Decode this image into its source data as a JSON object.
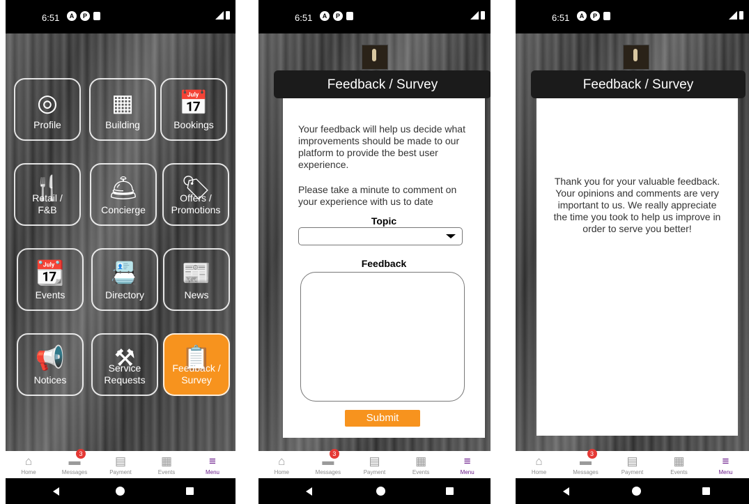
{
  "status_bar": {
    "time": "6:51",
    "icons": [
      "A",
      "P",
      "■"
    ]
  },
  "menu_tiles": [
    {
      "label": "Profile",
      "icon": "person-circle-icon",
      "glyph": "◎"
    },
    {
      "label": "Building",
      "icon": "building-icon",
      "glyph": "▦"
    },
    {
      "label": "Bookings",
      "icon": "calendar-clock-icon",
      "glyph": "📅"
    },
    {
      "label": "Retail /\nF&B",
      "icon": "fork-cup-icon",
      "glyph": "🍴"
    },
    {
      "label": "Concierge",
      "icon": "service-bell-icon",
      "glyph": "🛎"
    },
    {
      "label": "Offers /\nPromotions",
      "icon": "tag-icon",
      "glyph": "🏷"
    },
    {
      "label": "Events",
      "icon": "calendar-star-icon",
      "glyph": "📆"
    },
    {
      "label": "Directory",
      "icon": "contact-card-icon",
      "glyph": "📇"
    },
    {
      "label": "News",
      "icon": "newspaper-icon",
      "glyph": "📰"
    },
    {
      "label": "Notices",
      "icon": "megaphone-icon",
      "glyph": "📢"
    },
    {
      "label": "Service\nRequests",
      "icon": "tools-icon",
      "glyph": "⚒"
    },
    {
      "label": "Feedback /\nSurvey",
      "icon": "clipboard-list-icon",
      "glyph": "📋",
      "active": true
    }
  ],
  "tabbar": {
    "tabs": [
      {
        "label": "Home",
        "icon": "home-icon",
        "glyph": "⌂"
      },
      {
        "label": "Messages",
        "icon": "chat-icon",
        "glyph": "▬",
        "badge": "3"
      },
      {
        "label": "Payment",
        "icon": "payment-icon",
        "glyph": "▤"
      },
      {
        "label": "Events",
        "icon": "calendar-icon",
        "glyph": "▦"
      },
      {
        "label": "Menu",
        "icon": "hamburger-menu-icon",
        "glyph": "≡",
        "active": true
      }
    ]
  },
  "feedback": {
    "header": "Feedback / Survey",
    "intro_1": "Your feedback will help us decide what improvements should be made to our platform to provide the best user experience.",
    "intro_2": "Please take a minute to comment on your experience with us to date",
    "topic_label": "Topic",
    "topic_value": "",
    "feedback_label": "Feedback",
    "feedback_value": "",
    "submit_label": "Submit"
  },
  "thanks": {
    "header": "Feedback / Survey",
    "message": "Thank you for your valuable feedback. Your opinions and comments are very important to us. We really appreciate the time you took to help us improve in order to serve you better!"
  },
  "colors": {
    "accent": "#f7931e",
    "active_tab": "#6a1a8a",
    "badge": "#e53935",
    "header": "#1b1b1b"
  }
}
